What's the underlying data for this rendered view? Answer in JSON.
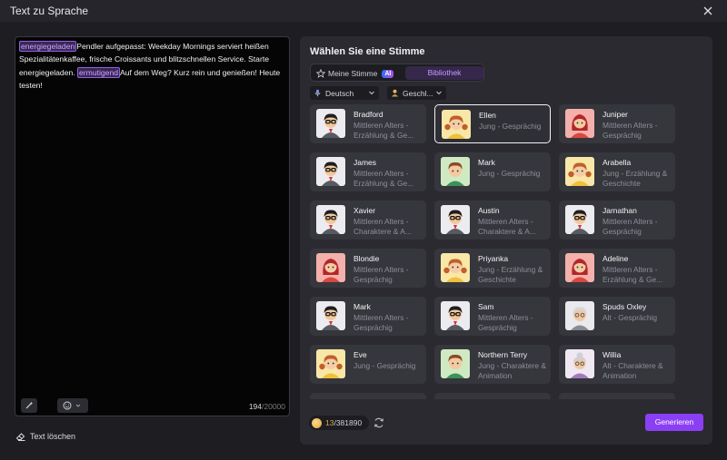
{
  "window": {
    "title": "Text zu Sprache"
  },
  "editor": {
    "tag1": "energiegeladen",
    "text1": "Pendler aufgepasst: Weekday Mornings serviert heißen Spezialitätenkaffee, frische Croissants und blitzschnellen Service. Starte energiegeladen. ",
    "tag2": "ermutigend",
    "text2": "Auf dem Weg? Kurz rein und genießen! Heute testen!",
    "char_count": "194",
    "char_max": "/20000"
  },
  "clear_label": "Text löschen",
  "panel": {
    "title": "Wählen Sie eine Stimme",
    "tab_mine": "Meine Stimme",
    "ai_badge": "AI",
    "tab_library": "Bibliothek",
    "lang_filter": "Deutsch",
    "gender_filter": "Geschl..."
  },
  "voices": [
    {
      "name": "Bradford",
      "desc": "Mittleren Alters - Erzählung & Ge...",
      "avatar": "man-glasses"
    },
    {
      "name": "Ellen",
      "desc": "Jung - Gesprächig",
      "avatar": "girl-pigtails",
      "selected": true
    },
    {
      "name": "Juniper",
      "desc": "Mittleren Alters - Gesprächig",
      "avatar": "woman-red"
    },
    {
      "name": "James",
      "desc": "Mittleren Alters - Erzählung & Ge...",
      "avatar": "man-glasses"
    },
    {
      "name": "Mark",
      "desc": "Jung - Gesprächig",
      "avatar": "boy-young"
    },
    {
      "name": "Arabella",
      "desc": "Jung - Erzählung & Geschichte",
      "avatar": "girl-pigtails"
    },
    {
      "name": "Xavier",
      "desc": "Mittleren Alters - Charaktere & A...",
      "avatar": "man-glasses"
    },
    {
      "name": "Austin",
      "desc": "Mittleren Alters - Charaktere & A...",
      "avatar": "man-glasses"
    },
    {
      "name": "Jarnathan",
      "desc": "Mittleren Alters - Gesprächig",
      "avatar": "man-glasses"
    },
    {
      "name": "Blondie",
      "desc": "Mittleren Alters - Gesprächig",
      "avatar": "woman-red"
    },
    {
      "name": "Priyanka",
      "desc": "Jung - Erzählung & Geschichte",
      "avatar": "girl-pigtails"
    },
    {
      "name": "Adeline",
      "desc": "Mittleren Alters - Erzählung & Ge...",
      "avatar": "woman-red"
    },
    {
      "name": "Mark",
      "desc": "Mittleren Alters - Gesprächig",
      "avatar": "man-glasses"
    },
    {
      "name": "Sam",
      "desc": "Mittleren Alters - Gesprächig",
      "avatar": "man-glasses"
    },
    {
      "name": "Spuds Oxley",
      "desc": "Alt - Gesprächig",
      "avatar": "old-man"
    },
    {
      "name": "Eve",
      "desc": "Jung - Gesprächig",
      "avatar": "girl-pigtails"
    },
    {
      "name": "Northern Terry",
      "desc": "Jung - Charaktere & Animation",
      "avatar": "boy-young"
    },
    {
      "name": "Willia",
      "desc": "Alt - Charaktere & Animation",
      "avatar": "old-woman"
    },
    {
      "name": "",
      "desc": "",
      "avatar": ""
    },
    {
      "name": "",
      "desc": "",
      "avatar": ""
    },
    {
      "name": "",
      "desc": "",
      "avatar": ""
    }
  ],
  "footer": {
    "credits_used": "13",
    "credits_total": "/381890",
    "generate_label": "Generieren"
  },
  "colors": {
    "accent": "#8b3ff5",
    "panel": "#2a2a30",
    "card": "#36363d"
  }
}
